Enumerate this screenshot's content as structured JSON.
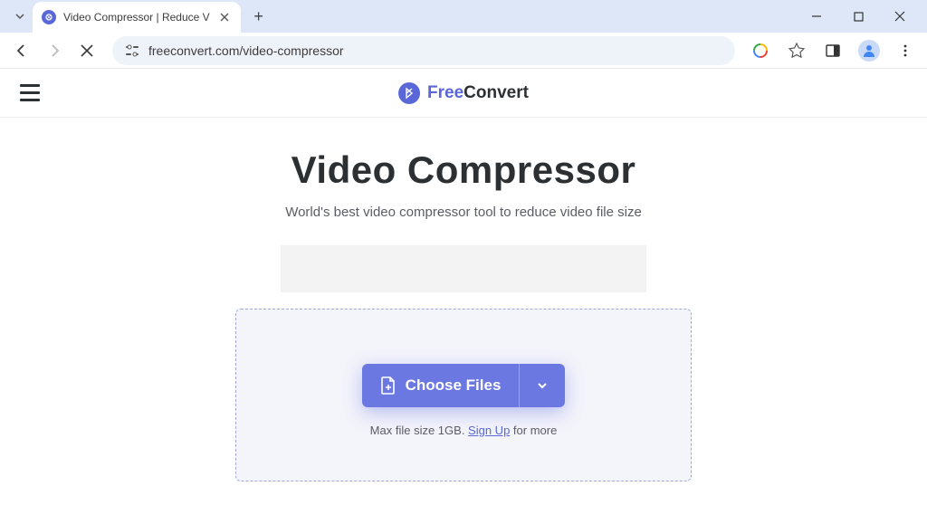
{
  "browser": {
    "tab_title": "Video Compressor | Reduce V",
    "url": "freeconvert.com/video-compressor"
  },
  "header": {
    "logo_free": "Free",
    "logo_convert": "Convert"
  },
  "main": {
    "title": "Video Compressor",
    "subtitle": "World's best video compressor tool to reduce video file size",
    "choose_files_label": "Choose Files",
    "hint_prefix": "Max file size 1GB. ",
    "hint_link": "Sign Up",
    "hint_suffix": " for more"
  }
}
